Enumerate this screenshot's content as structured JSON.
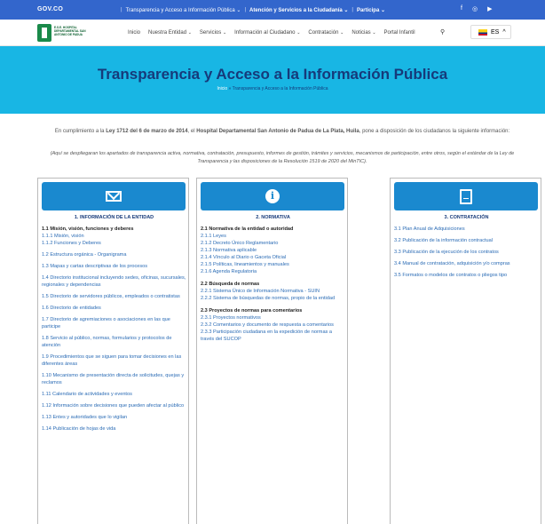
{
  "gov_bar": {
    "logo": "GOV.CO",
    "links": [
      "Transparencia y Acceso a Información Pública ⌄",
      "Atención y Servicios a la Ciudadanía ⌄",
      "Participa ⌄"
    ],
    "social": [
      "f",
      "◎",
      "▶"
    ]
  },
  "site": {
    "logo_text": "E.S.E. HOSPITAL DEPARTAMENTAL SAN ANTONIO DE PADUA"
  },
  "nav": {
    "items": [
      "Inicio",
      "Nuestra Entidad",
      "Servicios",
      "Información al Ciudadano",
      "Contratación",
      "Noticias",
      "Portal Infantil"
    ],
    "lang": "ES"
  },
  "hero": {
    "title": "Transparencia y Acceso a la Información Pública",
    "crumb_home": "Inicio",
    "crumb_current": " » Transparencia y Acceso a la Información Pública"
  },
  "intro": {
    "p1_a": "En cumplimiento a la ",
    "p1_law": "Ley 1712 del 6 de marzo de 2014",
    "p1_b": ", el ",
    "p1_org": "Hospital Departamental San Antonio de Padua de La Plata, Huila",
    "p1_c": ", pone a disposición de los ciudadanos la siguiente información:",
    "p2": "(Aquí se despliegaran los apartados de transparencia activa, normativa, contratación, presupuesto, informes de gestión, trámites y servicios, mecanismos de participación, entre otros, según el estándar de la Ley de Transparencia y las disposiciones de la Resolución 1519 de 2020 del MinTIC)."
  },
  "cards": [
    {
      "title": "1. INFORMACIÓN DE LA ENTIDAD",
      "icon": "mail-icon",
      "items": [
        {
          "t": "1.1 Misión, visión, funciones y deberes",
          "k": "hd"
        },
        {
          "t": "1.1.1 Misión, visión",
          "k": "sub"
        },
        {
          "t": "1.1.2 Funciones y Deberes",
          "k": "it"
        },
        {
          "t": "1.2 Estructura orgánica - Organigrama",
          "k": "it"
        },
        {
          "t": "1.3 Mapas y cartas descriptivas de los procesos",
          "k": "it"
        },
        {
          "t": "1.4 Directorio institucional incluyendo sedes, oficinas, sucursales, regionales y dependencias",
          "k": "it"
        },
        {
          "t": "1.5 Directorio de servidores públicos, empleados o contratistas",
          "k": "it"
        },
        {
          "t": "1.6 Directorio de entidades",
          "k": "it"
        },
        {
          "t": "1.7 Directorio de agremiaciones o asociaciones en las que participe",
          "k": "it"
        },
        {
          "t": "1.8 Servicio al público, normas, formularios y protocolos de atención",
          "k": "it"
        },
        {
          "t": "1.9 Procedimientos que se siguen para tomar decisiones en las diferentes áreas",
          "k": "it"
        },
        {
          "t": "1.10 Mecanismo de presentación directa de solicitudes, quejas y reclamos",
          "k": "it"
        },
        {
          "t": "1.11 Calendario de actividades y eventos",
          "k": "it"
        },
        {
          "t": "1.12 Información sobre decisiones que pueden afectar al público",
          "k": "it"
        },
        {
          "t": "1.13 Entes y autoridades que lo vigilan",
          "k": "it"
        },
        {
          "t": "1.14 Publicación de hojas de vida",
          "k": "it"
        }
      ]
    },
    {
      "title": "2. NORMATIVA",
      "icon": "info-icon",
      "items": [
        {
          "t": "2.1 Normativa de la entidad o autoridad",
          "k": "hd"
        },
        {
          "t": "2.1.1 Leyes",
          "k": "sub"
        },
        {
          "t": "2.1.2 Decreto Único Reglamentario",
          "k": "sub"
        },
        {
          "t": "2.1.3 Normativa aplicable",
          "k": "sub"
        },
        {
          "t": "2.1.4 Vínculo al Diario o Gaceta Oficial",
          "k": "sub"
        },
        {
          "t": "2.1.5 Políticas, lineamientos y manuales",
          "k": "sub"
        },
        {
          "t": "2.1.6 Agenda Regulatoria",
          "k": "it"
        },
        {
          "t": "2.2 Búsqueda de normas",
          "k": "hd gap"
        },
        {
          "t": "2.2.1 Sistema Único de Información Normativa - SUIN",
          "k": "sub"
        },
        {
          "t": "2.2.2 Sistema de búsquedas de normas, propio de la entidad",
          "k": "it"
        },
        {
          "t": "2.3 Proyectos de normas para comentarios",
          "k": "hd gap"
        },
        {
          "t": "2.3.1 Proyectos normativos",
          "k": "sub"
        },
        {
          "t": "2.3.2 Comentarios y documento de respuesta a comentarios",
          "k": "sub"
        },
        {
          "t": "2.3.3 Participación ciudadana en la expedición de normas a través del SUCOP",
          "k": "it"
        }
      ]
    },
    {
      "title": "3. CONTRATACIÓN",
      "icon": "document-icon",
      "items": [
        {
          "t": "3.1 Plan Anual de Adquisiciones",
          "k": "it"
        },
        {
          "t": "3.2 Publicación de la información contractual",
          "k": "it"
        },
        {
          "t": "3.3 Publicación de la ejecución de los contratos",
          "k": "it"
        },
        {
          "t": "3.4 Manual de contratación, adquisición y/o compras",
          "k": "it"
        },
        {
          "t": "3.5 Formatos o modelos de contratos o pliegos tipo",
          "k": "it"
        }
      ]
    }
  ]
}
